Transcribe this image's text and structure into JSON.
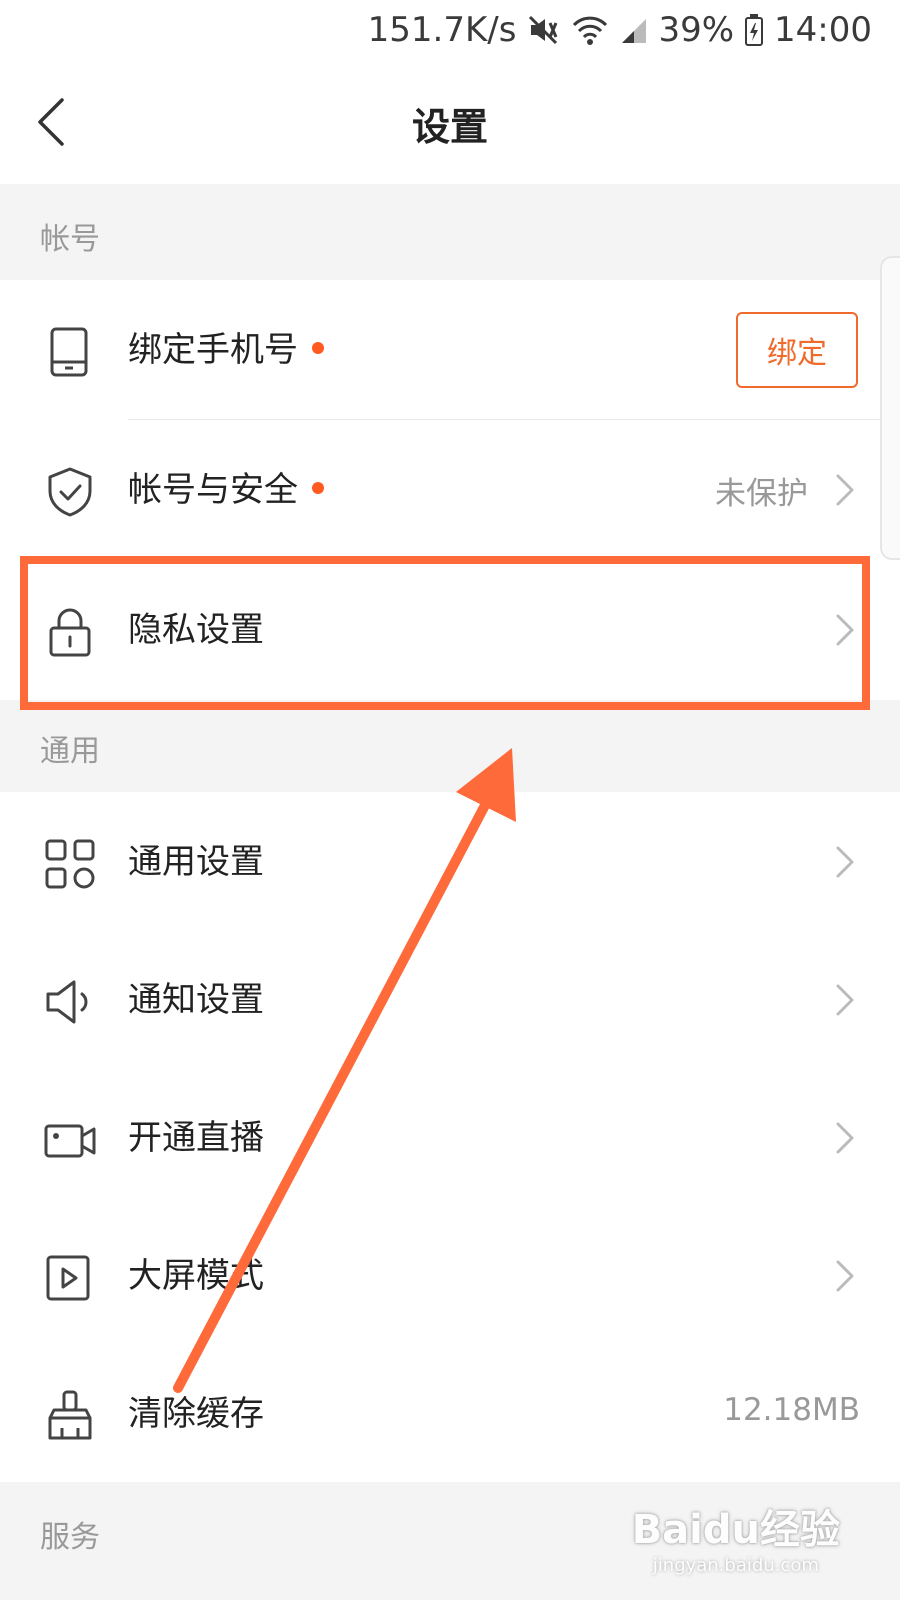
{
  "status_bar": {
    "net_speed": "151.7K/s",
    "battery": "39%",
    "time": "14:00",
    "icons": [
      "mute-icon",
      "wifi-icon",
      "signal-icon",
      "battery-icon"
    ]
  },
  "header": {
    "title": "设置",
    "back_icon": "back-arrow-icon"
  },
  "sections": {
    "account": {
      "header": "帐号",
      "items": [
        {
          "label": "绑定手机号",
          "icon": "phone-icon",
          "has_dot": true,
          "button": "绑定"
        },
        {
          "label": "帐号与安全",
          "icon": "shield-check-icon",
          "has_dot": true,
          "value": "未保护"
        },
        {
          "label": "隐私设置",
          "icon": "lock-icon"
        }
      ]
    },
    "general": {
      "header": "通用",
      "items": [
        {
          "label": "通用设置",
          "icon": "grid-icon"
        },
        {
          "label": "通知设置",
          "icon": "speaker-icon"
        },
        {
          "label": "开通直播",
          "icon": "video-camera-icon"
        },
        {
          "label": "大屏模式",
          "icon": "play-square-icon"
        },
        {
          "label": "清除缓存",
          "icon": "brush-icon",
          "value": "12.18MB"
        }
      ]
    },
    "service": {
      "header": "服务"
    }
  },
  "watermark": {
    "main": "Baidu经验",
    "sub": "jingyan.baidu.com"
  },
  "colors": {
    "accent": "#ff5a1f",
    "annotation": "#ff6a3a",
    "section_bg": "#f4f4f4",
    "muted_text": "#999999"
  }
}
